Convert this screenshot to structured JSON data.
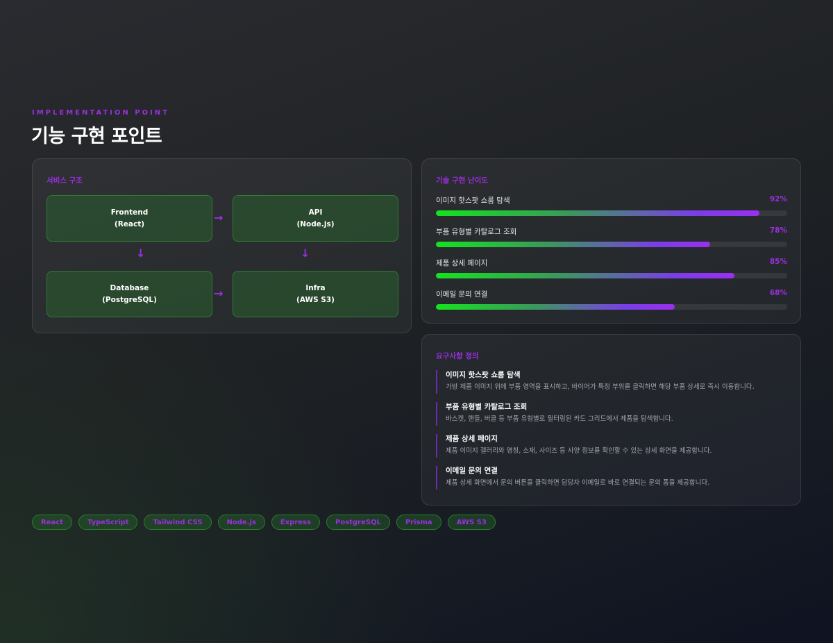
{
  "header": {
    "eyebrow": "IMPLEMENTATION POINT",
    "title": "기능 구현 포인트"
  },
  "architecture": {
    "label": "서비스 구조",
    "nodes": [
      {
        "name": "Frontend",
        "tech": "(React)"
      },
      {
        "name": "API",
        "tech": "(Node.js)"
      },
      {
        "name": "Database",
        "tech": "(PostgreSQL)"
      },
      {
        "name": "Infra",
        "tech": "(AWS S3)"
      }
    ],
    "arrow_right": "→",
    "arrow_down": "↓"
  },
  "difficulty": {
    "label": "기술 구현 난이도",
    "items": [
      {
        "name": "이미지 핫스팟 쇼룸 탐색",
        "percent_label": "92%",
        "value": 92
      },
      {
        "name": "부품 유형별 카탈로그 조회",
        "percent_label": "78%",
        "value": 78
      },
      {
        "name": "제품 상세 페이지",
        "percent_label": "85%",
        "value": 85
      },
      {
        "name": "이메일 문의 연결",
        "percent_label": "68%",
        "value": 68
      }
    ]
  },
  "requirements": {
    "label": "요구사항 정의",
    "items": [
      {
        "title": "이미지 핫스팟 쇼룸 탐색",
        "desc": "가방 제품 이미지 위에 부품 영역을 표시하고, 바이어가 특정 부위를 클릭하면 해당 부품 상세로 즉시 이동합니다."
      },
      {
        "title": "부품 유형별 카탈로그 조회",
        "desc": "바스켓, 핸들, 버클 등 부품 유형별로 필터링된 카드 그리드에서 제품을 탐색합니다."
      },
      {
        "title": "제품 상세 페이지",
        "desc": "제품 이미지 갤러리와 명칭, 소재, 사이즈 등 사양 정보를 확인할 수 있는 상세 화면을 제공합니다."
      },
      {
        "title": "이메일 문의 연결",
        "desc": "제품 상세 화면에서 문의 버튼을 클릭하면 담당자 이메일로 바로 연결되는 문의 폼을 제공합니다."
      }
    ]
  },
  "tech_tags": [
    "React",
    "TypeScript",
    "Tailwind CSS",
    "Node.js",
    "Express",
    "PostgreSQL",
    "Prisma",
    "AWS S3"
  ],
  "colors": {
    "accent": "#9a2fe0",
    "node_border": "#2f7a34",
    "bar_start": "#15e31f",
    "bar_end": "#9a2ff0"
  }
}
